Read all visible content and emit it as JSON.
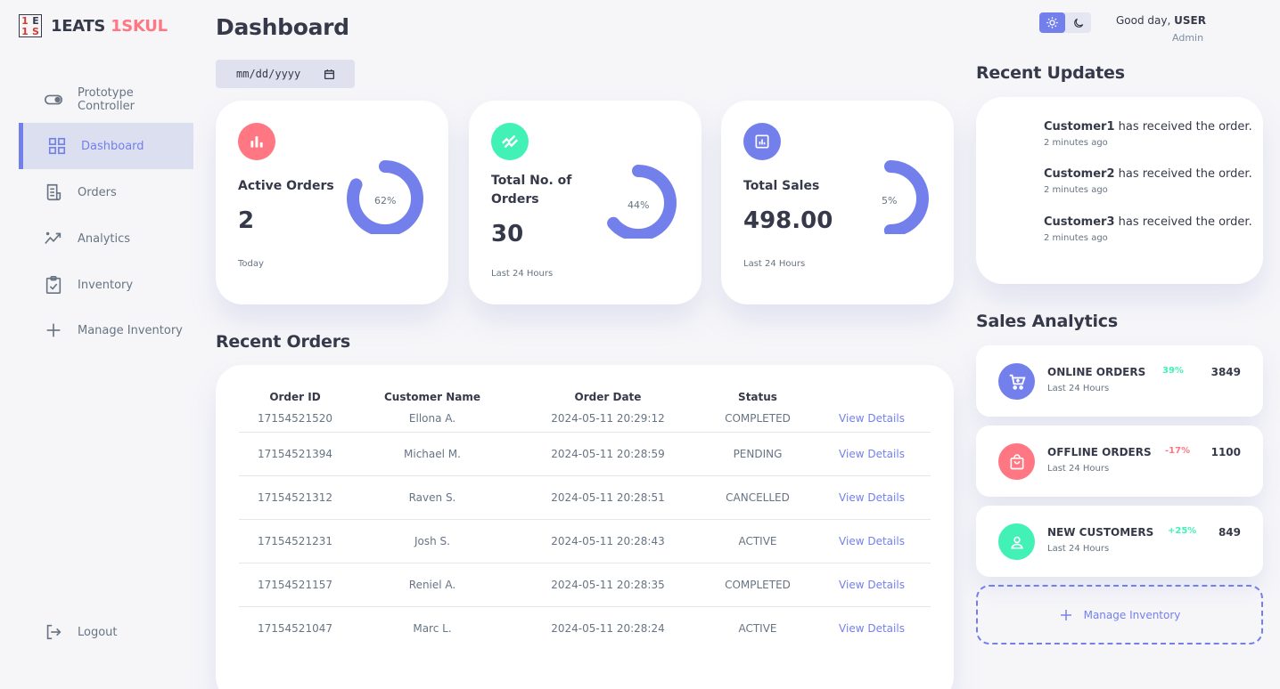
{
  "brand": {
    "mark": [
      "1",
      "E",
      "1",
      "S"
    ],
    "name_a": "1EATS",
    "name_b": "1SKUL"
  },
  "sidebar": {
    "items": [
      {
        "label": "Prototype Controller",
        "icon": "toggle-icon"
      },
      {
        "label": "Dashboard",
        "icon": "grid-icon"
      },
      {
        "label": "Orders",
        "icon": "receipt-icon"
      },
      {
        "label": "Analytics",
        "icon": "trend-icon"
      },
      {
        "label": "Inventory",
        "icon": "clipboard-check-icon"
      },
      {
        "label": "Manage Inventory",
        "icon": "plus-icon"
      }
    ],
    "logout": "Logout"
  },
  "header": {
    "title": "Dashboard",
    "date_placeholder": "mm/dd/yyyy",
    "greeting": "Good day, ",
    "user": "USER",
    "role": "Admin"
  },
  "cards": [
    {
      "title": "Active Orders",
      "value": "2",
      "sub": "Today",
      "percent": 62,
      "percent_label": "62%",
      "color": "#ff7782"
    },
    {
      "title": "Total No. of Orders",
      "value": "30",
      "sub": "Last 24 Hours",
      "percent": 44,
      "percent_label": "44%",
      "color": "#41f1b6"
    },
    {
      "title": "Total Sales",
      "value": "498.00",
      "sub": "Last 24 Hours",
      "percent": 5,
      "percent_label": "5%",
      "color": "#7380ec"
    }
  ],
  "recent_orders": {
    "title": "Recent Orders",
    "headers": [
      "Order ID",
      "Customer Name",
      "Order Date",
      "Status"
    ],
    "rows": [
      {
        "id": "17154521520",
        "name": "Ellona A.",
        "date": "2024-05-11 20:29:12",
        "status": "COMPLETED",
        "action": "View Details"
      },
      {
        "id": "17154521394",
        "name": "Michael M.",
        "date": "2024-05-11 20:28:59",
        "status": "PENDING",
        "action": "View Details"
      },
      {
        "id": "17154521312",
        "name": "Raven S.",
        "date": "2024-05-11 20:28:51",
        "status": "CANCELLED",
        "action": "View Details"
      },
      {
        "id": "17154521231",
        "name": "Josh S.",
        "date": "2024-05-11 20:28:43",
        "status": "ACTIVE",
        "action": "View Details"
      },
      {
        "id": "17154521157",
        "name": "Reniel A.",
        "date": "2024-05-11 20:28:35",
        "status": "COMPLETED",
        "action": "View Details"
      },
      {
        "id": "17154521047",
        "name": "Marc L.",
        "date": "2024-05-11 20:28:24",
        "status": "ACTIVE",
        "action": "View Details"
      }
    ]
  },
  "recent_updates": {
    "title": "Recent Updates",
    "items": [
      {
        "customer": "Customer1",
        "text": " has received the order.",
        "time": "2 minutes ago"
      },
      {
        "customer": "Customer2",
        "text": " has received the order.",
        "time": "2 minutes ago"
      },
      {
        "customer": "Customer3",
        "text": " has received the order.",
        "time": "2 minutes ago"
      }
    ]
  },
  "sales_analytics": {
    "title": "Sales Analytics",
    "items": [
      {
        "title": "ONLINE ORDERS",
        "sub": "Last 24 Hours",
        "pct": "39%",
        "value": "3849",
        "pct_color": "#41f1b6",
        "icon_color": "#7380ec"
      },
      {
        "title": "OFFLINE ORDERS",
        "sub": "Last 24 Hours",
        "pct": "-17%",
        "value": "1100",
        "pct_color": "#ff7782",
        "icon_color": "#ff7782"
      },
      {
        "title": "NEW CUSTOMERS",
        "sub": "Last 24 Hours",
        "pct": "+25%",
        "value": "849",
        "pct_color": "#41f1b6",
        "icon_color": "#41f1b6"
      }
    ],
    "manage": "Manage Inventory"
  },
  "colors": {
    "primary": "#7380ec",
    "danger": "#ff7782",
    "success": "#41f1b6",
    "background": "#f6f6f9"
  }
}
